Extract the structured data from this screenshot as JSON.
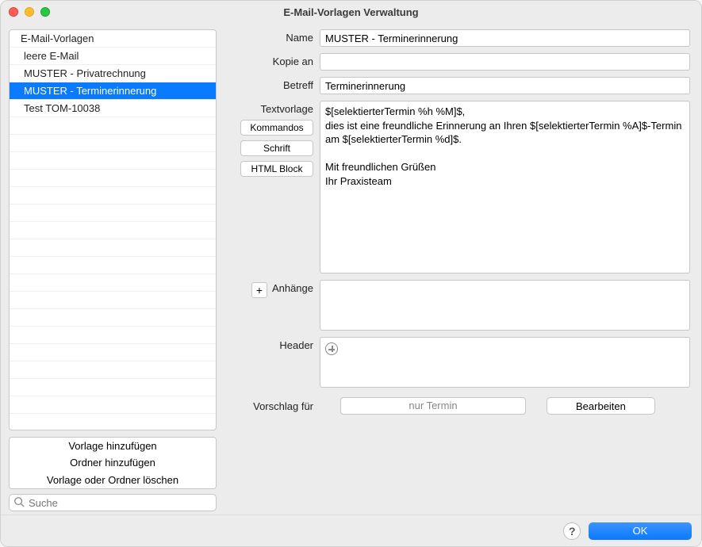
{
  "window": {
    "title": "E-Mail-Vorlagen Verwaltung"
  },
  "sidebar": {
    "folder": "E-Mail-Vorlagen",
    "items": [
      {
        "label": "leere E-Mail",
        "selected": false
      },
      {
        "label": "MUSTER - Privatrechnung",
        "selected": false
      },
      {
        "label": "MUSTER - Terminerinnerung",
        "selected": true
      },
      {
        "label": "Test TOM-10038",
        "selected": false
      }
    ],
    "buttons": {
      "add_template": "Vorlage hinzufügen",
      "add_folder": "Ordner hinzufügen",
      "delete": "Vorlage oder Ordner löschen"
    },
    "search_placeholder": "Suche"
  },
  "form": {
    "labels": {
      "name": "Name",
      "copy_to": "Kopie an",
      "subject": "Betreff",
      "text_template": "Textvorlage",
      "attachments": "Anhänge",
      "header": "Header",
      "suggestion_for": "Vorschlag für"
    },
    "values": {
      "name": "MUSTER - Terminerinnerung",
      "copy_to": "",
      "subject": "Terminerinnerung",
      "text_template": "$[selektierterTermin %h %M]$,\ndies ist eine freundliche Erinnerung an Ihren $[selektierterTermin %A]$-Termin am $[selektierterTermin %d]$.\n\nMit freundlichen Grüßen\nIhr Praxisteam",
      "suggestion_for": "nur Termin"
    },
    "buttons": {
      "commands": "Kommandos",
      "font": "Schrift",
      "html_block": "HTML Block",
      "edit": "Bearbeiten"
    }
  },
  "footer": {
    "help": "?",
    "ok": "OK"
  }
}
